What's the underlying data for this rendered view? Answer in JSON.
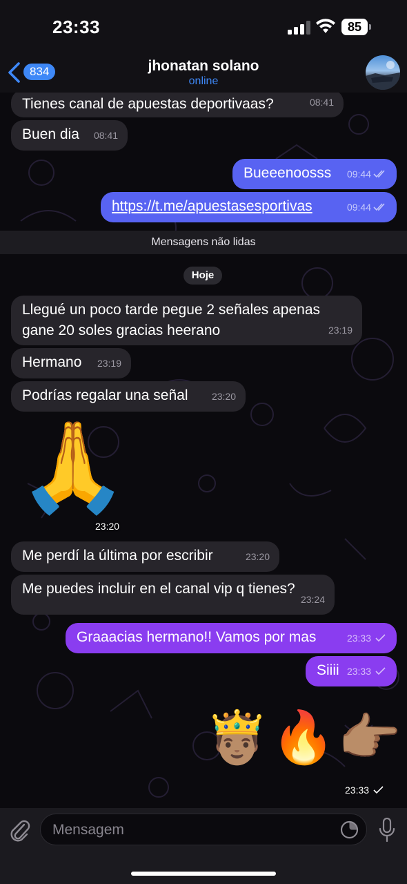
{
  "status_bar": {
    "time": "23:33",
    "battery": "85"
  },
  "header": {
    "back_count": "834",
    "contact_name": "jhonatan solano",
    "contact_status": "online"
  },
  "messages": [
    {
      "text": "Tienes canal de apuestas deportivaas?",
      "time": "08:41",
      "dir": "in"
    },
    {
      "text": "Buen dia",
      "time": "08:41",
      "dir": "in"
    },
    {
      "text": "Bueeenoosss",
      "time": "09:44",
      "dir": "out",
      "read": true
    },
    {
      "text": "https://t.me/apuestasesportivas",
      "time": "09:44",
      "dir": "out",
      "read": true
    },
    {
      "text": "Llegué un poco tarde pegue 2 señales apenas\ngane 20 soles gracias heerano",
      "time": "23:19",
      "dir": "in"
    },
    {
      "text": "Hermano",
      "time": "23:19",
      "dir": "in"
    },
    {
      "text": "Podrías regalar una señal",
      "time": "23:20",
      "dir": "in"
    },
    {
      "emoji": "🙏",
      "time": "23:20",
      "dir": "in"
    },
    {
      "text": "Me perdí la última por escribir",
      "time": "23:20",
      "dir": "in"
    },
    {
      "text": "Me puedes incluir en el canal vip q tienes?",
      "time": "23:24",
      "dir": "in"
    },
    {
      "text": "Graaacias hermano!! Vamos por mas",
      "time": "23:33",
      "dir": "out",
      "read": false
    },
    {
      "text": "Siiii",
      "time": "23:33",
      "dir": "out",
      "read": false
    },
    {
      "emoji": "🤴🏽🔥👉🏽",
      "time": "23:33",
      "dir": "out",
      "read": false
    }
  ],
  "unread_banner": "Mensagens não lidas",
  "date_separator": "Hoje",
  "input": {
    "placeholder": "Mensagem"
  },
  "icons": {
    "back": "chevron-left-icon",
    "signal": "cellular-signal-icon",
    "wifi": "wifi-icon",
    "battery": "battery-icon",
    "attach": "paperclip-icon",
    "sticker": "sticker-icon",
    "mic": "microphone-icon",
    "read_receipt": "double-check-icon",
    "sent_receipt": "single-check-icon"
  },
  "colors": {
    "incoming_bubble": "#27252b",
    "outgoing_bubble_purple": "#8a3df0",
    "outgoing_bubble_blue": "#5863f2",
    "accent": "#3e88f7",
    "background": "#0b0a0e"
  }
}
